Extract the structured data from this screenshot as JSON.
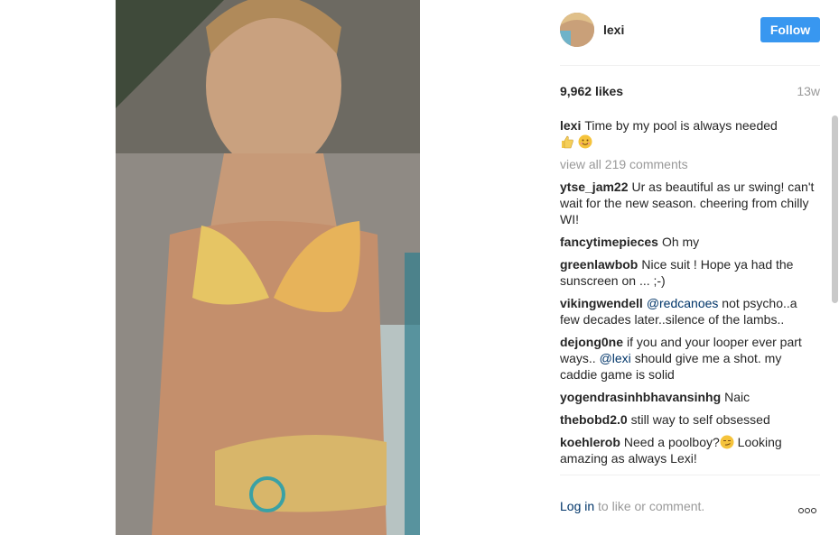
{
  "post": {
    "username": "lexi",
    "follow_label": "Follow",
    "likes_count": "9,962",
    "likes_word": "likes",
    "age": "13w",
    "caption": {
      "user": "lexi",
      "text": "Time by my pool is always needed"
    },
    "view_all": "view all 219 comments",
    "comments": [
      {
        "user": "ytse_jam22",
        "text": "Ur as beautiful as ur swing! can't wait for the new season. cheering from chilly WI!"
      },
      {
        "user": "fancytimepieces",
        "text": "Oh my"
      },
      {
        "user": "greenlawbob",
        "text": "Nice suit ! Hope ya had the sunscreen on ... ;-)"
      },
      {
        "user": "vikingwendell",
        "mention": "@redcanoes",
        "text": "not psycho..a few decades later..silence of the lambs.."
      },
      {
        "user": "dejong0ne",
        "text_a": "if you and your looper ever part ways..",
        "mention": "@lexi",
        "text_b": "should give me a shot. my caddie game is solid"
      },
      {
        "user": "yogendrasinhbhavansinhg",
        "text": "Naic"
      },
      {
        "user": "thebobd2.0",
        "text": "still way to self obsessed"
      },
      {
        "user": "koehlerob",
        "text_a": "Need a poolboy?",
        "text_b": "Looking amazing as always Lexi!"
      }
    ],
    "login_link": "Log in",
    "login_rest": "to like or comment."
  },
  "icons": [
    "thumbs-up-icon",
    "smile-emoji-icon",
    "smirk-emoji-icon",
    "more-options-icon"
  ],
  "colors": {
    "follow": "#3897f0",
    "link": "#003569",
    "muted": "#999999"
  }
}
